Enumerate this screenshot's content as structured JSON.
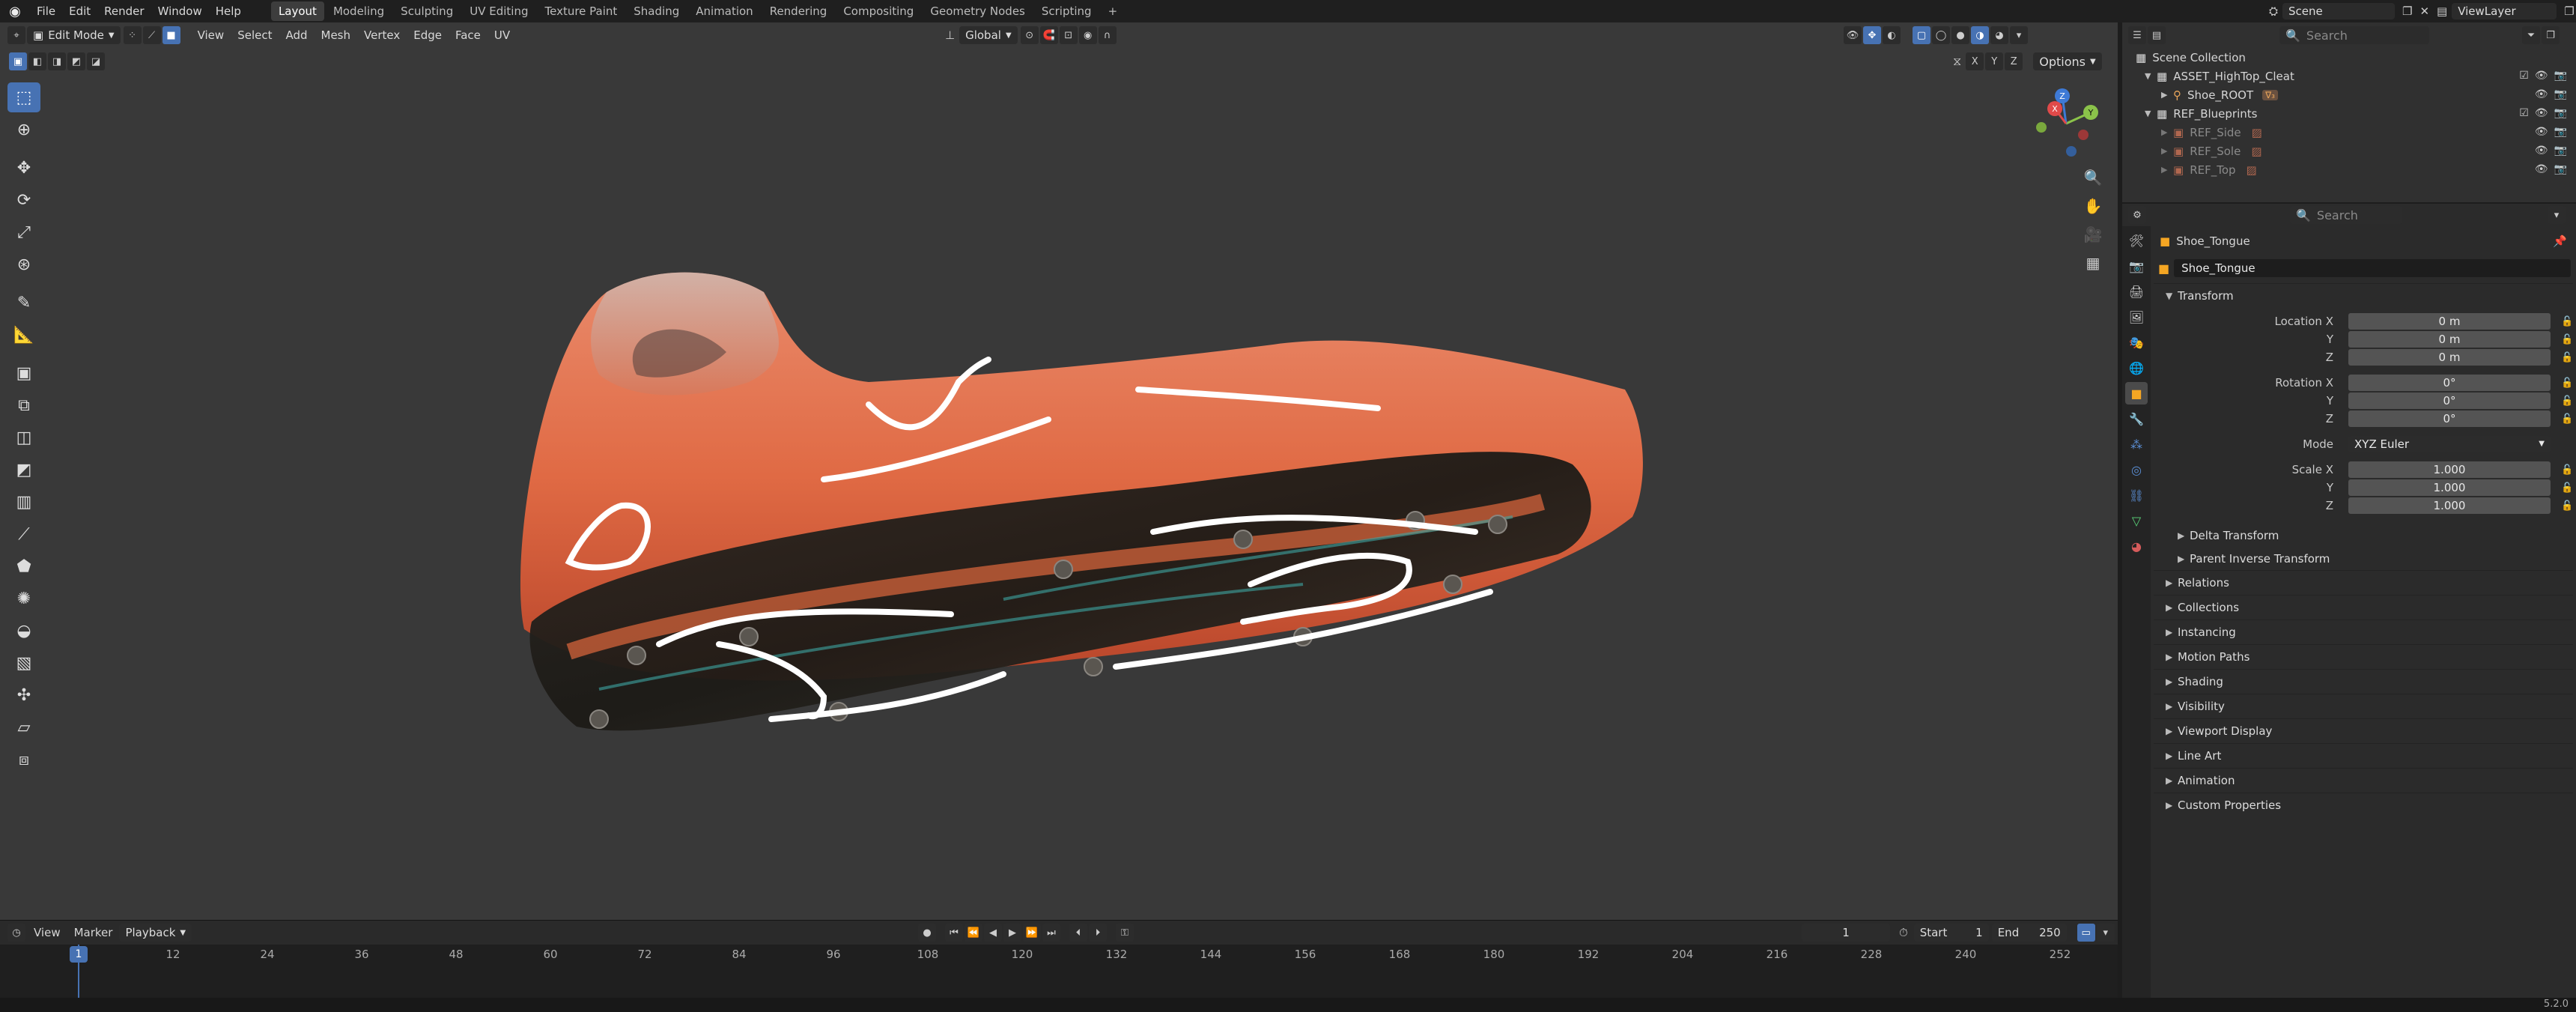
{
  "topbar": {
    "menus": [
      "File",
      "Edit",
      "Render",
      "Window",
      "Help"
    ],
    "workspaces": [
      "Layout",
      "Modeling",
      "Sculpting",
      "UV Editing",
      "Texture Paint",
      "Shading",
      "Animation",
      "Rendering",
      "Compositing",
      "Geometry Nodes",
      "Scripting"
    ],
    "active_workspace": "Layout",
    "add_tab": "+",
    "scene_label": "Scene",
    "viewlayer_label": "ViewLayer"
  },
  "viewport_header": {
    "mode": "Edit Mode",
    "menus": [
      "View",
      "Select",
      "Add",
      "Mesh",
      "Vertex",
      "Edge",
      "Face",
      "UV"
    ],
    "transform_orientation": "Global",
    "options_label": "Options",
    "axis_labels": [
      "X",
      "Y",
      "Z"
    ]
  },
  "gizmo": {
    "x_label": "X",
    "y_label": "Y",
    "z_label": "Z"
  },
  "timeline": {
    "menus": [
      "View",
      "Marker",
      "Playback"
    ],
    "current_frame": "1",
    "start_label": "Start",
    "start_value": "1",
    "end_label": "End",
    "end_value": "250",
    "ticks": [
      "1",
      "12",
      "24",
      "36",
      "48",
      "60",
      "72",
      "84",
      "96",
      "108",
      "120",
      "132",
      "144",
      "156",
      "168",
      "180",
      "192",
      "204",
      "216",
      "228",
      "240",
      "252"
    ]
  },
  "status": {
    "version": "5.2.0"
  },
  "outliner": {
    "search_placeholder": "Search",
    "root": "Scene Collection",
    "items": [
      {
        "label": "ASSET_HighTop_Cleat",
        "level": 1,
        "type": "collection"
      },
      {
        "label": "Shoe_ROOT",
        "level": 2,
        "type": "object"
      },
      {
        "label": "REF_Blueprints",
        "level": 1,
        "type": "collection"
      },
      {
        "label": "REF_Side",
        "level": 2,
        "type": "image"
      },
      {
        "label": "REF_Sole",
        "level": 2,
        "type": "image"
      },
      {
        "label": "REF_Top",
        "level": 2,
        "type": "image"
      }
    ]
  },
  "properties": {
    "search_placeholder": "Search",
    "object_name": "Shoe_Tongue",
    "name_field": "Shoe_Tongue",
    "transform_title": "Transform",
    "location": {
      "label": "Location X",
      "y": "Y",
      "z": "Z",
      "values": [
        "0 m",
        "0 m",
        "0 m"
      ]
    },
    "rotation": {
      "label": "Rotation X",
      "y": "Y",
      "z": "Z",
      "values": [
        "0°",
        "0°",
        "0°"
      ]
    },
    "mode_label": "Mode",
    "mode_value": "XYZ Euler",
    "scale": {
      "label": "Scale X",
      "y": "Y",
      "z": "Z",
      "values": [
        "1.000",
        "1.000",
        "1.000"
      ]
    },
    "sub_sections": [
      "Delta Transform",
      "Parent Inverse Transform"
    ],
    "sections": [
      "Relations",
      "Collections",
      "Instancing",
      "Motion Paths",
      "Shading",
      "Visibility",
      "Viewport Display",
      "Line Art",
      "Animation",
      "Custom Properties"
    ]
  }
}
